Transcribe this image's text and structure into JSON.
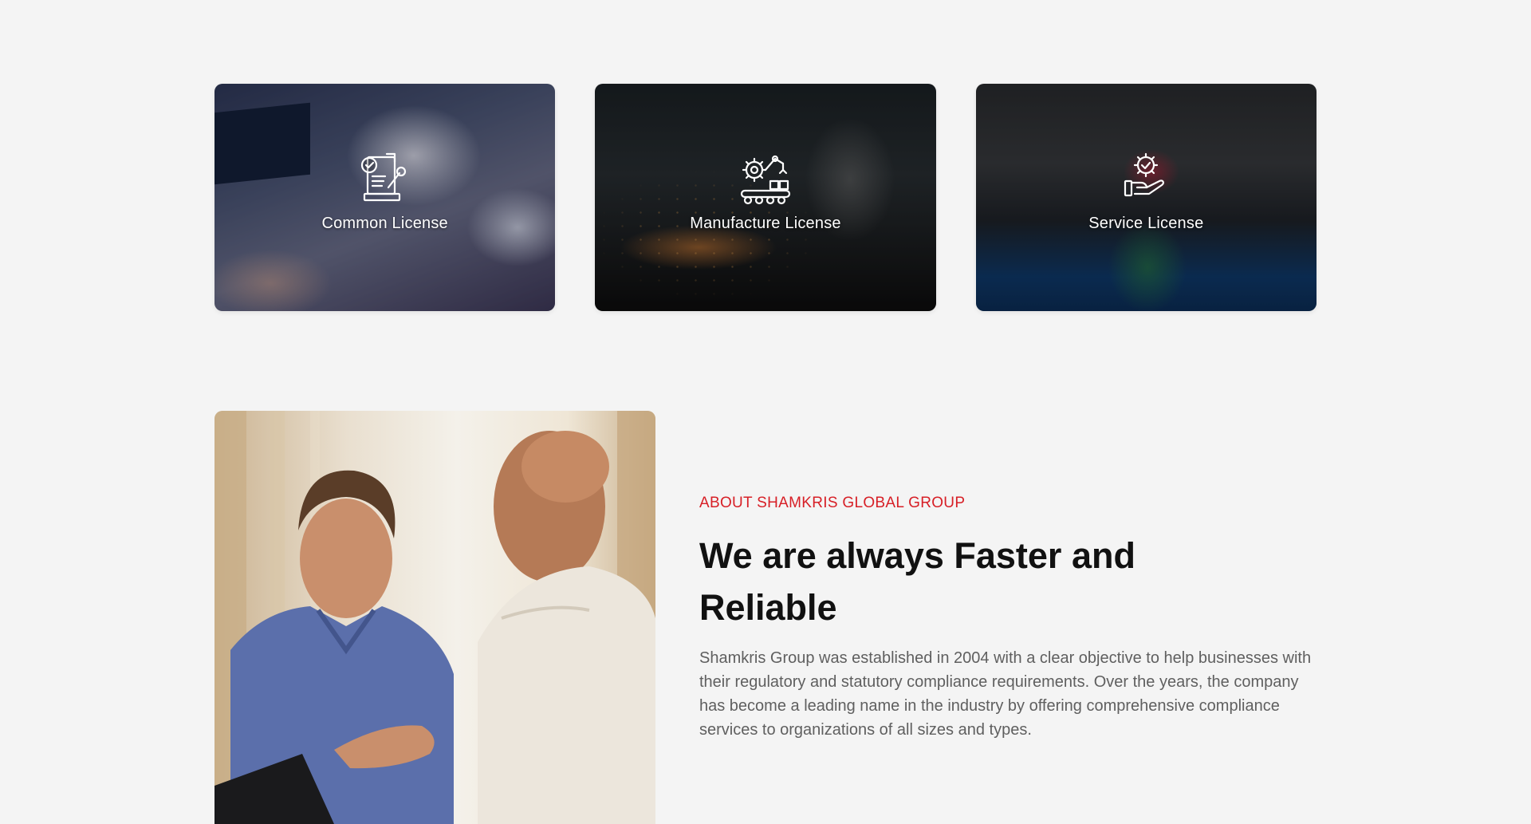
{
  "cards": [
    {
      "label": "Common License",
      "icon": "document-approval-icon"
    },
    {
      "label": "Manufacture License",
      "icon": "robotic-arm-conveyor-icon"
    },
    {
      "label": "Service License",
      "icon": "gear-hand-icon"
    }
  ],
  "about": {
    "eyebrow": "ABOUT SHAMKRIS GLOBAL GROUP",
    "headline": "We are always Faster and Reliable",
    "description": "Shamkris Group was established in 2004 with a clear objective to help businesses with their regulatory and statutory compliance requirements. Over the years, the company has become a leading name in the industry by offering comprehensive compliance services to organizations of all sizes and types.",
    "photo": "two-businessmen-meeting-photo"
  },
  "colors": {
    "background": "#f4f4f4",
    "accent": "#d71f26",
    "heading": "#111111",
    "body_text": "#5f5f5f",
    "card_label": "#ffffff"
  }
}
